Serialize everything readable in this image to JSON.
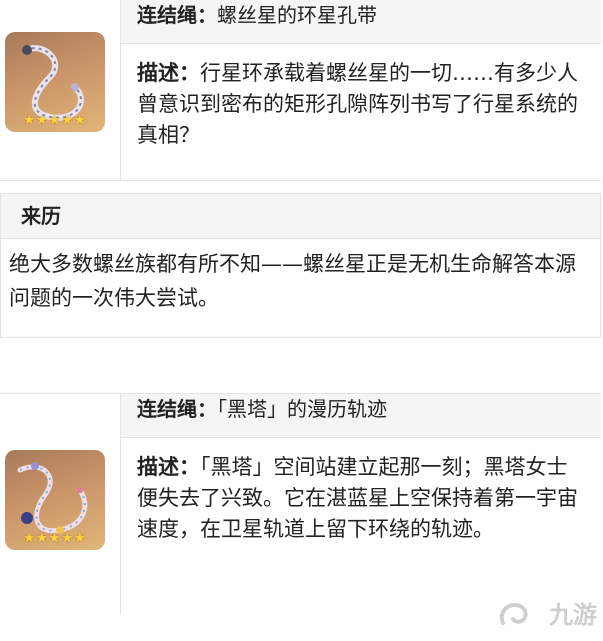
{
  "item1": {
    "name_label": "连结绳：",
    "name": "螺丝星的环星孔带",
    "desc_label": "描述：",
    "desc": "行星环承载着螺丝星的一切……有多少人曾意识到密布的矩形孔隙阵列书写了行星系统的真相？",
    "stars": "★★★★★"
  },
  "origin": {
    "heading": "来历",
    "text": "绝大多数螺丝族都有所不知——螺丝星正是无机生命解答本源问题的一次伟大尝试。"
  },
  "item2": {
    "name_label": "连结绳：",
    "name": "「黑塔」的漫历轨迹",
    "desc_label": "描述：",
    "desc": "「黑塔」空间站建立起那一刻；黑塔女士便失去了兴致。它在湛蓝星上空保持着第一宇宙速度，在卫星轨道上留下环绕的轨迹。",
    "stars": "★★★★★"
  },
  "watermark": "九游",
  "colors": {
    "header_bg": "#f5f5f5",
    "border": "#e3e3e3",
    "star": "#ffd440",
    "icon_bg": "#c99468"
  }
}
